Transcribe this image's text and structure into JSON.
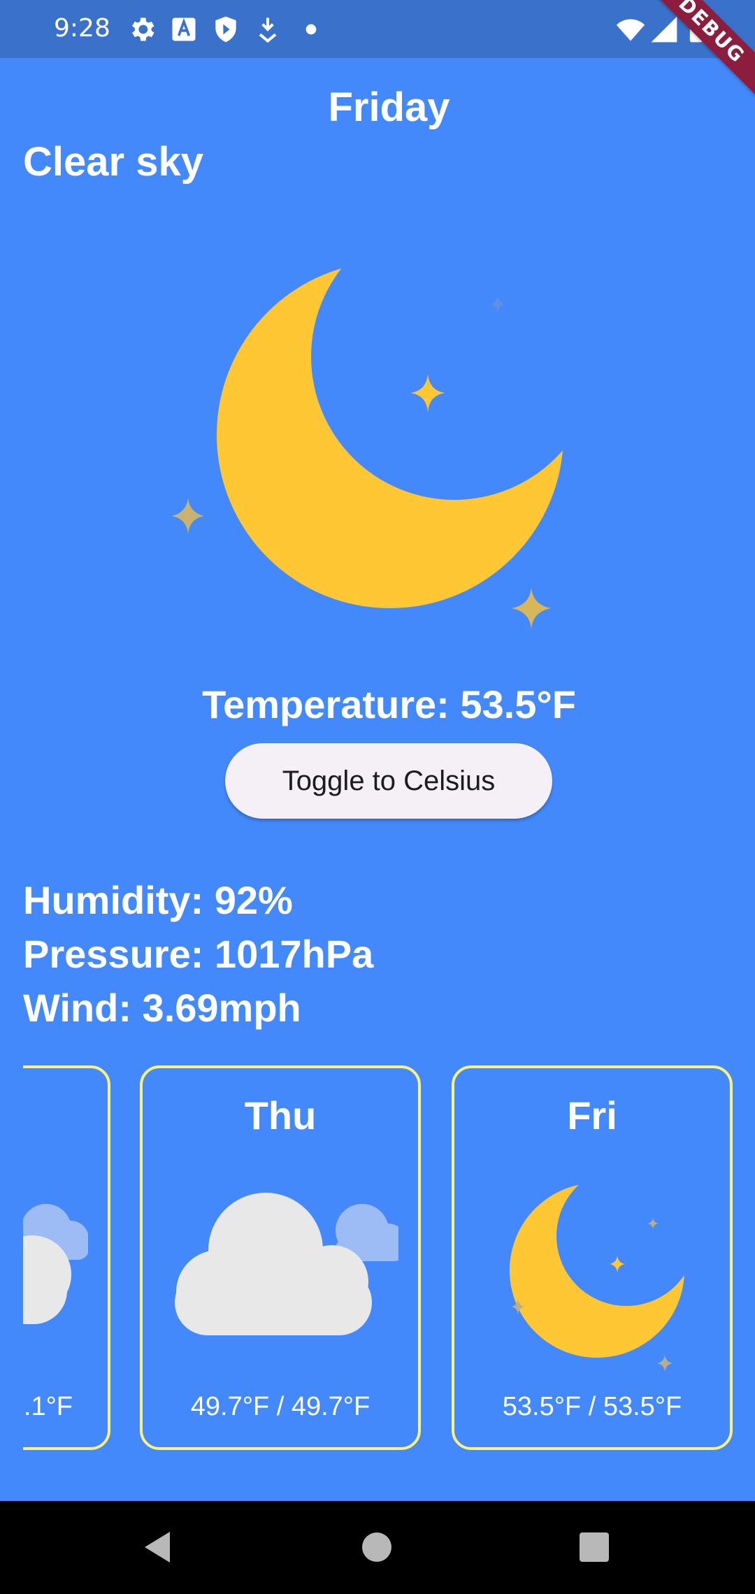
{
  "status_bar": {
    "time": "9:28",
    "left_icons": [
      "settings-icon",
      "a-notification-icon",
      "shield-icon",
      "download-icon",
      "dot-icon"
    ],
    "right_icons": [
      "wifi-icon",
      "signal-icon",
      "battery-icon"
    ]
  },
  "debug_banner": "DEBUG",
  "weather": {
    "day": "Friday",
    "condition": "Clear sky",
    "icon": "moon-stars-icon",
    "temperature": "Temperature: 53.5°F",
    "toggle_label": "Toggle to Celsius",
    "humidity": "Humidity: 92%",
    "pressure": "Pressure: 1017hPa",
    "wind": "Wind: 3.69mph"
  },
  "forecast": [
    {
      "day": "",
      "temps": ".1°F",
      "icon": "cloud-icon"
    },
    {
      "day": "Thu",
      "temps": "49.7°F / 49.7°F",
      "icon": "cloud-icon"
    },
    {
      "day": "Fri",
      "temps": "53.5°F / 53.5°F",
      "icon": "moon-stars-icon"
    }
  ],
  "nav": {
    "buttons": [
      "back-icon",
      "home-icon",
      "recents-icon"
    ]
  },
  "colors": {
    "background": "#4489fc",
    "status_bar": "#3a72cb",
    "moon": "#ffc733",
    "card_border": "#fff176",
    "button_bg": "#f5eff6",
    "cloud": "#e8e8e8",
    "cloud_back": "#9dbcf5"
  }
}
